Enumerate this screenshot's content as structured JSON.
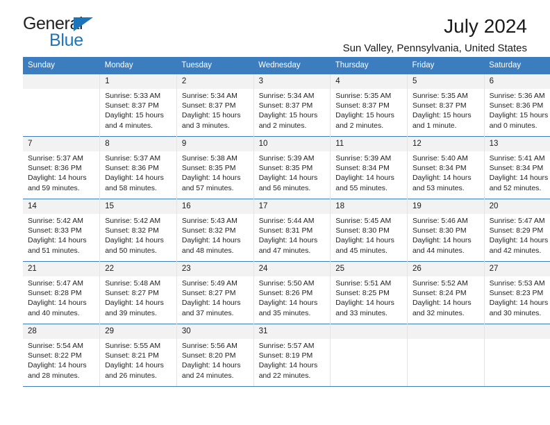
{
  "brand": {
    "name_top": "General",
    "name_bottom": "Blue",
    "accent_color": "#1b75bb"
  },
  "header": {
    "title": "July 2024",
    "subtitle": "Sun Valley, Pennsylvania, United States"
  },
  "calendar": {
    "header_bg": "#3b7dbf",
    "weekdays": [
      "Sunday",
      "Monday",
      "Tuesday",
      "Wednesday",
      "Thursday",
      "Friday",
      "Saturday"
    ],
    "weeks": [
      [
        {
          "day": ""
        },
        {
          "day": "1",
          "sunrise": "Sunrise: 5:33 AM",
          "sunset": "Sunset: 8:37 PM",
          "daylight_1": "Daylight: 15 hours",
          "daylight_2": "and 4 minutes."
        },
        {
          "day": "2",
          "sunrise": "Sunrise: 5:34 AM",
          "sunset": "Sunset: 8:37 PM",
          "daylight_1": "Daylight: 15 hours",
          "daylight_2": "and 3 minutes."
        },
        {
          "day": "3",
          "sunrise": "Sunrise: 5:34 AM",
          "sunset": "Sunset: 8:37 PM",
          "daylight_1": "Daylight: 15 hours",
          "daylight_2": "and 2 minutes."
        },
        {
          "day": "4",
          "sunrise": "Sunrise: 5:35 AM",
          "sunset": "Sunset: 8:37 PM",
          "daylight_1": "Daylight: 15 hours",
          "daylight_2": "and 2 minutes."
        },
        {
          "day": "5",
          "sunrise": "Sunrise: 5:35 AM",
          "sunset": "Sunset: 8:37 PM",
          "daylight_1": "Daylight: 15 hours",
          "daylight_2": "and 1 minute."
        },
        {
          "day": "6",
          "sunrise": "Sunrise: 5:36 AM",
          "sunset": "Sunset: 8:36 PM",
          "daylight_1": "Daylight: 15 hours",
          "daylight_2": "and 0 minutes."
        }
      ],
      [
        {
          "day": "7",
          "sunrise": "Sunrise: 5:37 AM",
          "sunset": "Sunset: 8:36 PM",
          "daylight_1": "Daylight: 14 hours",
          "daylight_2": "and 59 minutes."
        },
        {
          "day": "8",
          "sunrise": "Sunrise: 5:37 AM",
          "sunset": "Sunset: 8:36 PM",
          "daylight_1": "Daylight: 14 hours",
          "daylight_2": "and 58 minutes."
        },
        {
          "day": "9",
          "sunrise": "Sunrise: 5:38 AM",
          "sunset": "Sunset: 8:35 PM",
          "daylight_1": "Daylight: 14 hours",
          "daylight_2": "and 57 minutes."
        },
        {
          "day": "10",
          "sunrise": "Sunrise: 5:39 AM",
          "sunset": "Sunset: 8:35 PM",
          "daylight_1": "Daylight: 14 hours",
          "daylight_2": "and 56 minutes."
        },
        {
          "day": "11",
          "sunrise": "Sunrise: 5:39 AM",
          "sunset": "Sunset: 8:34 PM",
          "daylight_1": "Daylight: 14 hours",
          "daylight_2": "and 55 minutes."
        },
        {
          "day": "12",
          "sunrise": "Sunrise: 5:40 AM",
          "sunset": "Sunset: 8:34 PM",
          "daylight_1": "Daylight: 14 hours",
          "daylight_2": "and 53 minutes."
        },
        {
          "day": "13",
          "sunrise": "Sunrise: 5:41 AM",
          "sunset": "Sunset: 8:34 PM",
          "daylight_1": "Daylight: 14 hours",
          "daylight_2": "and 52 minutes."
        }
      ],
      [
        {
          "day": "14",
          "sunrise": "Sunrise: 5:42 AM",
          "sunset": "Sunset: 8:33 PM",
          "daylight_1": "Daylight: 14 hours",
          "daylight_2": "and 51 minutes."
        },
        {
          "day": "15",
          "sunrise": "Sunrise: 5:42 AM",
          "sunset": "Sunset: 8:32 PM",
          "daylight_1": "Daylight: 14 hours",
          "daylight_2": "and 50 minutes."
        },
        {
          "day": "16",
          "sunrise": "Sunrise: 5:43 AM",
          "sunset": "Sunset: 8:32 PM",
          "daylight_1": "Daylight: 14 hours",
          "daylight_2": "and 48 minutes."
        },
        {
          "day": "17",
          "sunrise": "Sunrise: 5:44 AM",
          "sunset": "Sunset: 8:31 PM",
          "daylight_1": "Daylight: 14 hours",
          "daylight_2": "and 47 minutes."
        },
        {
          "day": "18",
          "sunrise": "Sunrise: 5:45 AM",
          "sunset": "Sunset: 8:30 PM",
          "daylight_1": "Daylight: 14 hours",
          "daylight_2": "and 45 minutes."
        },
        {
          "day": "19",
          "sunrise": "Sunrise: 5:46 AM",
          "sunset": "Sunset: 8:30 PM",
          "daylight_1": "Daylight: 14 hours",
          "daylight_2": "and 44 minutes."
        },
        {
          "day": "20",
          "sunrise": "Sunrise: 5:47 AM",
          "sunset": "Sunset: 8:29 PM",
          "daylight_1": "Daylight: 14 hours",
          "daylight_2": "and 42 minutes."
        }
      ],
      [
        {
          "day": "21",
          "sunrise": "Sunrise: 5:47 AM",
          "sunset": "Sunset: 8:28 PM",
          "daylight_1": "Daylight: 14 hours",
          "daylight_2": "and 40 minutes."
        },
        {
          "day": "22",
          "sunrise": "Sunrise: 5:48 AM",
          "sunset": "Sunset: 8:27 PM",
          "daylight_1": "Daylight: 14 hours",
          "daylight_2": "and 39 minutes."
        },
        {
          "day": "23",
          "sunrise": "Sunrise: 5:49 AM",
          "sunset": "Sunset: 8:27 PM",
          "daylight_1": "Daylight: 14 hours",
          "daylight_2": "and 37 minutes."
        },
        {
          "day": "24",
          "sunrise": "Sunrise: 5:50 AM",
          "sunset": "Sunset: 8:26 PM",
          "daylight_1": "Daylight: 14 hours",
          "daylight_2": "and 35 minutes."
        },
        {
          "day": "25",
          "sunrise": "Sunrise: 5:51 AM",
          "sunset": "Sunset: 8:25 PM",
          "daylight_1": "Daylight: 14 hours",
          "daylight_2": "and 33 minutes."
        },
        {
          "day": "26",
          "sunrise": "Sunrise: 5:52 AM",
          "sunset": "Sunset: 8:24 PM",
          "daylight_1": "Daylight: 14 hours",
          "daylight_2": "and 32 minutes."
        },
        {
          "day": "27",
          "sunrise": "Sunrise: 5:53 AM",
          "sunset": "Sunset: 8:23 PM",
          "daylight_1": "Daylight: 14 hours",
          "daylight_2": "and 30 minutes."
        }
      ],
      [
        {
          "day": "28",
          "sunrise": "Sunrise: 5:54 AM",
          "sunset": "Sunset: 8:22 PM",
          "daylight_1": "Daylight: 14 hours",
          "daylight_2": "and 28 minutes."
        },
        {
          "day": "29",
          "sunrise": "Sunrise: 5:55 AM",
          "sunset": "Sunset: 8:21 PM",
          "daylight_1": "Daylight: 14 hours",
          "daylight_2": "and 26 minutes."
        },
        {
          "day": "30",
          "sunrise": "Sunrise: 5:56 AM",
          "sunset": "Sunset: 8:20 PM",
          "daylight_1": "Daylight: 14 hours",
          "daylight_2": "and 24 minutes."
        },
        {
          "day": "31",
          "sunrise": "Sunrise: 5:57 AM",
          "sunset": "Sunset: 8:19 PM",
          "daylight_1": "Daylight: 14 hours",
          "daylight_2": "and 22 minutes."
        },
        {
          "day": ""
        },
        {
          "day": ""
        },
        {
          "day": ""
        }
      ]
    ]
  }
}
